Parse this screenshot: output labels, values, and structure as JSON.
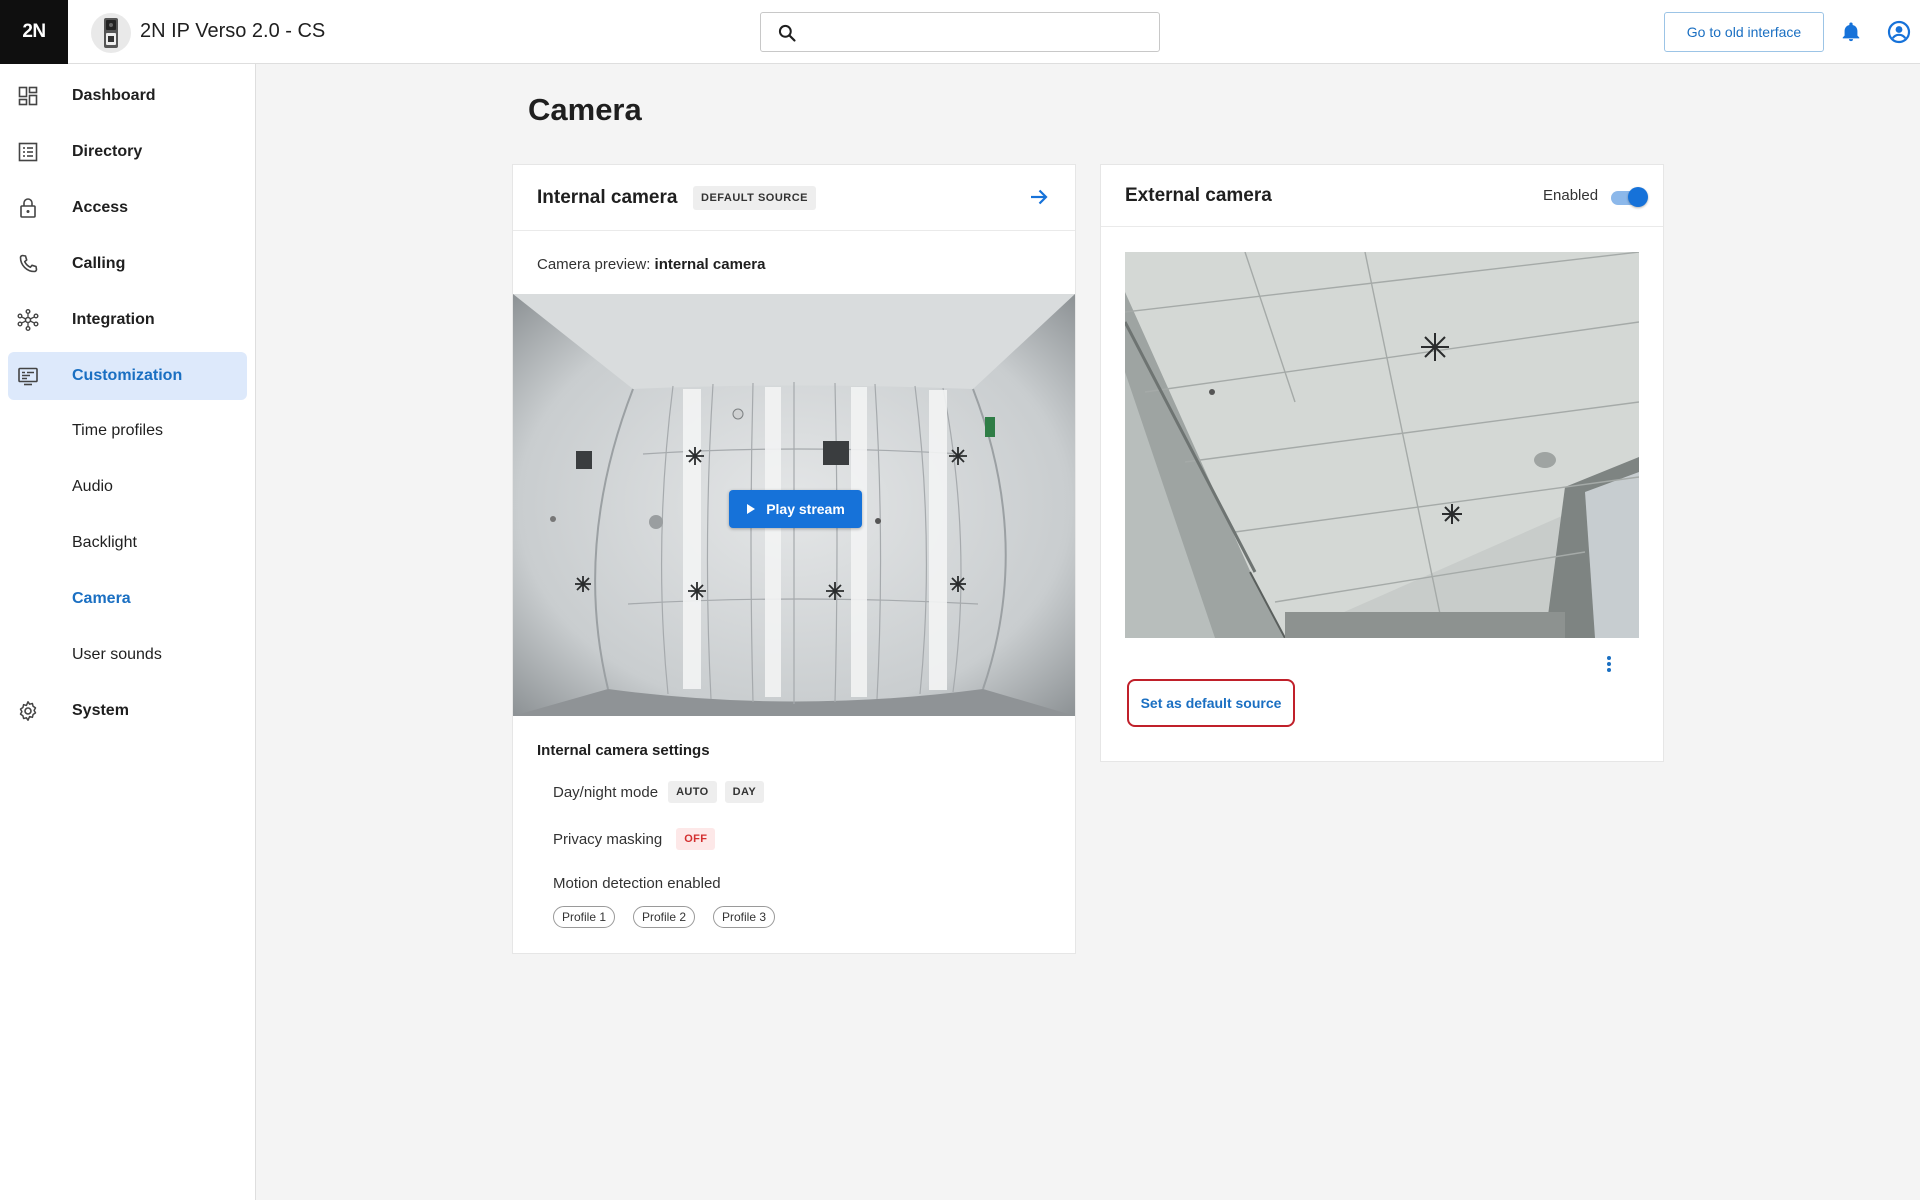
{
  "app": {
    "logo_text": "2N",
    "device_title": "2N IP Verso 2.0 - CS",
    "search_placeholder": "",
    "old_interface_label": "Go to old interface",
    "accent_color": "#1672d9"
  },
  "sidebar": {
    "items": [
      {
        "label": "Dashboard",
        "icon": "dashboard-icon"
      },
      {
        "label": "Directory",
        "icon": "directory-icon"
      },
      {
        "label": "Access",
        "icon": "lock-icon"
      },
      {
        "label": "Calling",
        "icon": "phone-icon"
      },
      {
        "label": "Integration",
        "icon": "integration-icon"
      },
      {
        "label": "Customization",
        "icon": "customization-icon",
        "active": true
      },
      {
        "label": "System",
        "icon": "gear-icon"
      }
    ],
    "sub_items": [
      {
        "label": "Time profiles"
      },
      {
        "label": "Audio"
      },
      {
        "label": "Backlight"
      },
      {
        "label": "Camera",
        "current": true
      },
      {
        "label": "User sounds"
      }
    ]
  },
  "page": {
    "title": "Camera"
  },
  "internal_camera": {
    "title": "Internal camera",
    "default_tag": "DEFAULT SOURCE",
    "preview_prefix": "Camera preview:",
    "preview_name": "internal camera",
    "play_label": "Play stream",
    "settings_title": "Internal camera settings",
    "day_night_label": "Day/night mode",
    "day_night_chips": [
      "AUTO",
      "DAY"
    ],
    "privacy_label": "Privacy masking",
    "privacy_value": "OFF",
    "motion_label": "Motion detection enabled",
    "profiles": [
      "Profile 1",
      "Profile 2",
      "Profile 3"
    ]
  },
  "external_camera": {
    "title": "External camera",
    "enabled_label": "Enabled",
    "enabled": true,
    "set_default_label": "Set as default source"
  }
}
